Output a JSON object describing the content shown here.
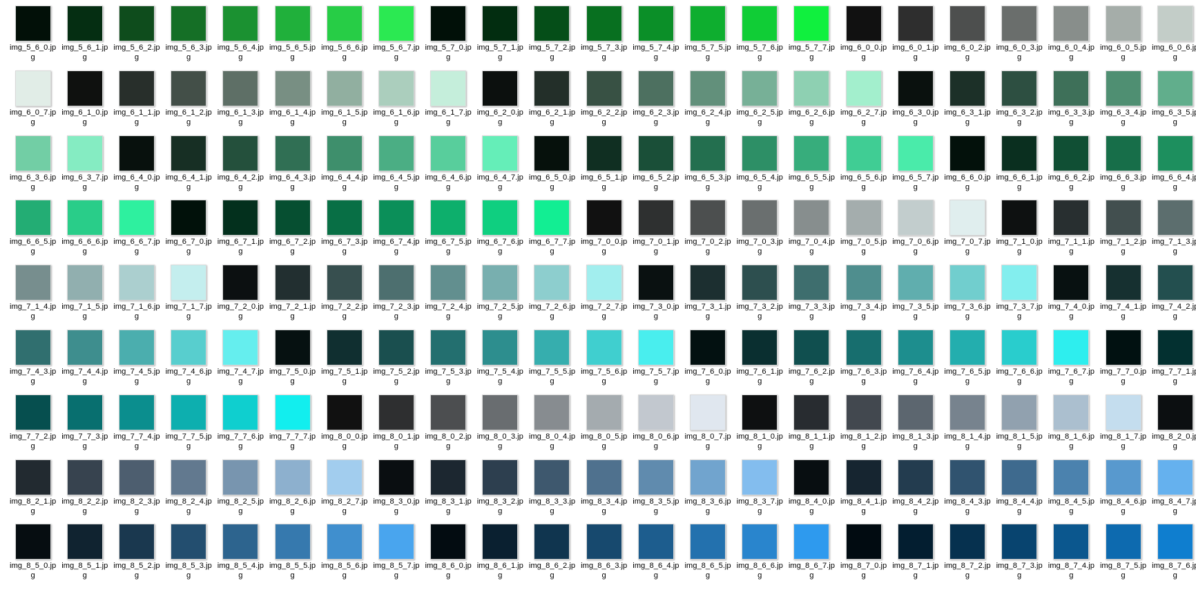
{
  "view": {
    "extension": ".jpg",
    "items": [
      {
        "name": "img_5_6_0",
        "color": "#021008"
      },
      {
        "name": "img_5_6_1",
        "color": "#052e12"
      },
      {
        "name": "img_5_6_2",
        "color": "#0e4c1c"
      },
      {
        "name": "img_5_6_3",
        "color": "#156f26"
      },
      {
        "name": "img_5_6_4",
        "color": "#1b9131"
      },
      {
        "name": "img_5_6_5",
        "color": "#20b03b"
      },
      {
        "name": "img_5_6_6",
        "color": "#27cd46"
      },
      {
        "name": "img_5_6_7",
        "color": "#2be952"
      },
      {
        "name": "img_5_7_0",
        "color": "#011008"
      },
      {
        "name": "img_5_7_1",
        "color": "#022d10"
      },
      {
        "name": "img_5_7_2",
        "color": "#054e18"
      },
      {
        "name": "img_5_7_3",
        "color": "#087020"
      },
      {
        "name": "img_5_7_4",
        "color": "#0b8f28"
      },
      {
        "name": "img_5_7_5",
        "color": "#0eae2f"
      },
      {
        "name": "img_5_7_6",
        "color": "#10cd36"
      },
      {
        "name": "img_5_7_7",
        "color": "#10f03e"
      },
      {
        "name": "img_6_0_0",
        "color": "#111111"
      },
      {
        "name": "img_6_0_1",
        "color": "#2e2e2e"
      },
      {
        "name": "img_6_0_2",
        "color": "#4d4f4e"
      },
      {
        "name": "img_6_0_3",
        "color": "#6a6e6c"
      },
      {
        "name": "img_6_0_4",
        "color": "#888e8b"
      },
      {
        "name": "img_6_0_5",
        "color": "#a5ada9"
      },
      {
        "name": "img_6_0_6",
        "color": "#c3cdc8"
      },
      {
        "name": "img_6_0_7",
        "color": "#e1ede7"
      },
      {
        "name": "img_6_1_0",
        "color": "#0f110f"
      },
      {
        "name": "img_6_1_1",
        "color": "#282f2b"
      },
      {
        "name": "img_6_1_2",
        "color": "#434f48"
      },
      {
        "name": "img_6_1_3",
        "color": "#5e6f66"
      },
      {
        "name": "img_6_1_4",
        "color": "#788f83"
      },
      {
        "name": "img_6_1_5",
        "color": "#91afa0"
      },
      {
        "name": "img_6_1_6",
        "color": "#abcebd"
      },
      {
        "name": "img_6_1_7",
        "color": "#c5eedb"
      },
      {
        "name": "img_6_2_0",
        "color": "#0c100e"
      },
      {
        "name": "img_6_2_1",
        "color": "#232f29"
      },
      {
        "name": "img_6_2_2",
        "color": "#385144"
      },
      {
        "name": "img_6_2_3",
        "color": "#4d7060"
      },
      {
        "name": "img_6_2_4",
        "color": "#62907b"
      },
      {
        "name": "img_6_2_5",
        "color": "#77b097"
      },
      {
        "name": "img_6_2_6",
        "color": "#8ed0b2"
      },
      {
        "name": "img_6_2_7",
        "color": "#a3efcd"
      },
      {
        "name": "img_6_3_0",
        "color": "#0a110e"
      },
      {
        "name": "img_6_3_1",
        "color": "#1c3028"
      },
      {
        "name": "img_6_3_2",
        "color": "#2d4f41"
      },
      {
        "name": "img_6_3_3",
        "color": "#3e7059"
      },
      {
        "name": "img_6_3_4",
        "color": "#4f8f72"
      },
      {
        "name": "img_6_3_5",
        "color": "#61ae8c"
      },
      {
        "name": "img_6_3_6",
        "color": "#72cea5"
      },
      {
        "name": "img_6_3_7",
        "color": "#85ecc2"
      },
      {
        "name": "img_6_4_0",
        "color": "#08110d"
      },
      {
        "name": "img_6_4_1",
        "color": "#172f24"
      },
      {
        "name": "img_6_4_2",
        "color": "#24503c"
      },
      {
        "name": "img_6_4_3",
        "color": "#306f54"
      },
      {
        "name": "img_6_4_4",
        "color": "#3e8f6c"
      },
      {
        "name": "img_6_4_5",
        "color": "#4bae84"
      },
      {
        "name": "img_6_4_6",
        "color": "#58ce9c"
      },
      {
        "name": "img_6_4_7",
        "color": "#65eeb8"
      },
      {
        "name": "img_6_5_0",
        "color": "#06110c"
      },
      {
        "name": "img_6_5_1",
        "color": "#102f22"
      },
      {
        "name": "img_6_5_2",
        "color": "#1a4f38"
      },
      {
        "name": "img_6_5_3",
        "color": "#236f4f"
      },
      {
        "name": "img_6_5_4",
        "color": "#2d8f66"
      },
      {
        "name": "img_6_5_5",
        "color": "#37ad7c"
      },
      {
        "name": "img_6_5_6",
        "color": "#40cd94"
      },
      {
        "name": "img_6_5_7",
        "color": "#4aebaa"
      },
      {
        "name": "img_6_6_0",
        "color": "#03110b"
      },
      {
        "name": "img_6_6_1",
        "color": "#0a2f1f"
      },
      {
        "name": "img_6_6_2",
        "color": "#104f34"
      },
      {
        "name": "img_6_6_3",
        "color": "#176e49"
      },
      {
        "name": "img_6_6_4",
        "color": "#1d8f5e"
      },
      {
        "name": "img_6_6_5",
        "color": "#23ad74"
      },
      {
        "name": "img_6_6_6",
        "color": "#29cd89"
      },
      {
        "name": "img_6_6_7",
        "color": "#2ef09f"
      },
      {
        "name": "img_6_7_0",
        "color": "#01110a"
      },
      {
        "name": "img_6_7_1",
        "color": "#03301d"
      },
      {
        "name": "img_6_7_2",
        "color": "#064f31"
      },
      {
        "name": "img_6_7_3",
        "color": "#086f45"
      },
      {
        "name": "img_6_7_4",
        "color": "#0b8f59"
      },
      {
        "name": "img_6_7_5",
        "color": "#0daf6c"
      },
      {
        "name": "img_6_7_6",
        "color": "#0fcf80"
      },
      {
        "name": "img_6_7_7",
        "color": "#12ee93"
      },
      {
        "name": "img_7_0_0",
        "color": "#111111"
      },
      {
        "name": "img_7_0_1",
        "color": "#2e3030"
      },
      {
        "name": "img_7_0_2",
        "color": "#4c4f4f"
      },
      {
        "name": "img_7_0_3",
        "color": "#6a6f6f"
      },
      {
        "name": "img_7_0_4",
        "color": "#878e8e"
      },
      {
        "name": "img_7_0_5",
        "color": "#a4adad"
      },
      {
        "name": "img_7_0_6",
        "color": "#c2cdcd"
      },
      {
        "name": "img_7_0_7",
        "color": "#e0eeee"
      },
      {
        "name": "img_7_1_0",
        "color": "#0e1111"
      },
      {
        "name": "img_7_1_1",
        "color": "#282f30"
      },
      {
        "name": "img_7_1_2",
        "color": "#424f4f"
      },
      {
        "name": "img_7_1_3",
        "color": "#5c6e6e"
      },
      {
        "name": "img_7_1_4",
        "color": "#778e8e"
      },
      {
        "name": "img_7_1_5",
        "color": "#91afaf"
      },
      {
        "name": "img_7_1_6",
        "color": "#abcfcf"
      },
      {
        "name": "img_7_1_7",
        "color": "#c4eeee"
      },
      {
        "name": "img_7_2_0",
        "color": "#0c1011"
      },
      {
        "name": "img_7_2_1",
        "color": "#222f30"
      },
      {
        "name": "img_7_2_2",
        "color": "#374f4f"
      },
      {
        "name": "img_7_2_3",
        "color": "#4d6f6f"
      },
      {
        "name": "img_7_2_4",
        "color": "#628f8f"
      },
      {
        "name": "img_7_2_5",
        "color": "#78afaf"
      },
      {
        "name": "img_7_2_6",
        "color": "#8dcece"
      },
      {
        "name": "img_7_2_7",
        "color": "#a2eeee"
      },
      {
        "name": "img_7_3_0",
        "color": "#0a1111"
      },
      {
        "name": "img_7_3_1",
        "color": "#1c2f30"
      },
      {
        "name": "img_7_3_2",
        "color": "#2d4f4f"
      },
      {
        "name": "img_7_3_3",
        "color": "#3e6e6e"
      },
      {
        "name": "img_7_3_4",
        "color": "#4f8e8e"
      },
      {
        "name": "img_7_3_5",
        "color": "#60aeae"
      },
      {
        "name": "img_7_3_6",
        "color": "#71cece"
      },
      {
        "name": "img_7_3_7",
        "color": "#83eeee"
      },
      {
        "name": "img_7_4_0",
        "color": "#081111"
      },
      {
        "name": "img_7_4_1",
        "color": "#163030"
      },
      {
        "name": "img_7_4_2",
        "color": "#234f4f"
      },
      {
        "name": "img_7_4_3",
        "color": "#306f6f"
      },
      {
        "name": "img_7_4_4",
        "color": "#3e8e8e"
      },
      {
        "name": "img_7_4_5",
        "color": "#4baeae"
      },
      {
        "name": "img_7_4_6",
        "color": "#58cece"
      },
      {
        "name": "img_7_4_7",
        "color": "#65eeee"
      },
      {
        "name": "img_7_5_0",
        "color": "#061111"
      },
      {
        "name": "img_7_5_1",
        "color": "#102f30"
      },
      {
        "name": "img_7_5_2",
        "color": "#1a4f4f"
      },
      {
        "name": "img_7_5_3",
        "color": "#236f6f"
      },
      {
        "name": "img_7_5_4",
        "color": "#2d8e8e"
      },
      {
        "name": "img_7_5_5",
        "color": "#36aeae"
      },
      {
        "name": "img_7_5_6",
        "color": "#40cfcf"
      },
      {
        "name": "img_7_5_7",
        "color": "#49eeee"
      },
      {
        "name": "img_7_6_0",
        "color": "#031111"
      },
      {
        "name": "img_7_6_1",
        "color": "#0a2f30"
      },
      {
        "name": "img_7_6_2",
        "color": "#104f4f"
      },
      {
        "name": "img_7_6_3",
        "color": "#176e6e"
      },
      {
        "name": "img_7_6_4",
        "color": "#1d8e8e"
      },
      {
        "name": "img_7_6_5",
        "color": "#23aeae"
      },
      {
        "name": "img_7_6_6",
        "color": "#29cdcd"
      },
      {
        "name": "img_7_6_7",
        "color": "#2eeeee"
      },
      {
        "name": "img_7_7_0",
        "color": "#011111"
      },
      {
        "name": "img_7_7_1",
        "color": "#033030"
      },
      {
        "name": "img_7_7_2",
        "color": "#064f4f"
      },
      {
        "name": "img_7_7_3",
        "color": "#086f6f"
      },
      {
        "name": "img_7_7_4",
        "color": "#0b8e8e"
      },
      {
        "name": "img_7_7_5",
        "color": "#0dafaf"
      },
      {
        "name": "img_7_7_6",
        "color": "#0fcfcf"
      },
      {
        "name": "img_7_7_7",
        "color": "#12eeee"
      },
      {
        "name": "img_8_0_0",
        "color": "#111111"
      },
      {
        "name": "img_8_0_1",
        "color": "#2e2f30"
      },
      {
        "name": "img_8_0_2",
        "color": "#4c4e50"
      },
      {
        "name": "img_8_0_3",
        "color": "#696d70"
      },
      {
        "name": "img_8_0_4",
        "color": "#878c90"
      },
      {
        "name": "img_8_0_5",
        "color": "#a4abaf"
      },
      {
        "name": "img_8_0_6",
        "color": "#c2c8cf"
      },
      {
        "name": "img_8_0_7",
        "color": "#e0e7ef"
      },
      {
        "name": "img_8_1_0",
        "color": "#0e1011"
      },
      {
        "name": "img_8_1_1",
        "color": "#282c30"
      },
      {
        "name": "img_8_1_2",
        "color": "#42484f"
      },
      {
        "name": "img_8_1_3",
        "color": "#5c666f"
      },
      {
        "name": "img_8_1_4",
        "color": "#77838e"
      },
      {
        "name": "img_8_1_5",
        "color": "#91a1af"
      },
      {
        "name": "img_8_1_6",
        "color": "#abbfcf"
      },
      {
        "name": "img_8_1_7",
        "color": "#c4ddee"
      },
      {
        "name": "img_8_2_0",
        "color": "#0c0f11"
      },
      {
        "name": "img_8_2_1",
        "color": "#222a30"
      },
      {
        "name": "img_8_2_2",
        "color": "#37434f"
      },
      {
        "name": "img_8_2_3",
        "color": "#4d5e6f"
      },
      {
        "name": "img_8_2_4",
        "color": "#62798f"
      },
      {
        "name": "img_8_2_5",
        "color": "#7895af"
      },
      {
        "name": "img_8_2_6",
        "color": "#8db0ce"
      },
      {
        "name": "img_8_2_7",
        "color": "#a2cdee"
      },
      {
        "name": "img_8_3_0",
        "color": "#0a0e11"
      },
      {
        "name": "img_8_3_1",
        "color": "#1c2730"
      },
      {
        "name": "img_8_3_2",
        "color": "#2d3f4f"
      },
      {
        "name": "img_8_3_3",
        "color": "#3e586e"
      },
      {
        "name": "img_8_3_4",
        "color": "#4f718e"
      },
      {
        "name": "img_8_3_5",
        "color": "#608bae"
      },
      {
        "name": "img_8_3_6",
        "color": "#71a4ce"
      },
      {
        "name": "img_8_3_7",
        "color": "#83bdee"
      },
      {
        "name": "img_8_4_0",
        "color": "#080e11"
      },
      {
        "name": "img_8_4_1",
        "color": "#162530"
      },
      {
        "name": "img_8_4_2",
        "color": "#233c4f"
      },
      {
        "name": "img_8_4_3",
        "color": "#30536f"
      },
      {
        "name": "img_8_4_4",
        "color": "#3e6a8e"
      },
      {
        "name": "img_8_4_5",
        "color": "#4b82ae"
      },
      {
        "name": "img_8_4_6",
        "color": "#5899ce"
      },
      {
        "name": "img_8_4_7",
        "color": "#65b1ee"
      },
      {
        "name": "img_8_5_0",
        "color": "#060d11"
      },
      {
        "name": "img_8_5_1",
        "color": "#102330"
      },
      {
        "name": "img_8_5_2",
        "color": "#1a384f"
      },
      {
        "name": "img_8_5_3",
        "color": "#234e6f"
      },
      {
        "name": "img_8_5_4",
        "color": "#2d648e"
      },
      {
        "name": "img_8_5_5",
        "color": "#3679ae"
      },
      {
        "name": "img_8_5_6",
        "color": "#408fce"
      },
      {
        "name": "img_8_5_7",
        "color": "#49a5ee"
      },
      {
        "name": "img_8_6_0",
        "color": "#030c11"
      },
      {
        "name": "img_8_6_1",
        "color": "#0a2030"
      },
      {
        "name": "img_8_6_2",
        "color": "#10354f"
      },
      {
        "name": "img_8_6_3",
        "color": "#17496e"
      },
      {
        "name": "img_8_6_4",
        "color": "#1d5d8e"
      },
      {
        "name": "img_8_6_5",
        "color": "#2371ae"
      },
      {
        "name": "img_8_6_6",
        "color": "#2985cd"
      },
      {
        "name": "img_8_6_7",
        "color": "#2e9aee"
      },
      {
        "name": "img_8_7_0",
        "color": "#010b11"
      },
      {
        "name": "img_8_7_1",
        "color": "#031e30"
      },
      {
        "name": "img_8_7_2",
        "color": "#06314f"
      },
      {
        "name": "img_8_7_3",
        "color": "#08446f"
      },
      {
        "name": "img_8_7_4",
        "color": "#0b578e"
      },
      {
        "name": "img_8_7_5",
        "color": "#0d6aaf"
      },
      {
        "name": "img_8_7_6",
        "color": "#0f7ecf"
      }
    ]
  }
}
